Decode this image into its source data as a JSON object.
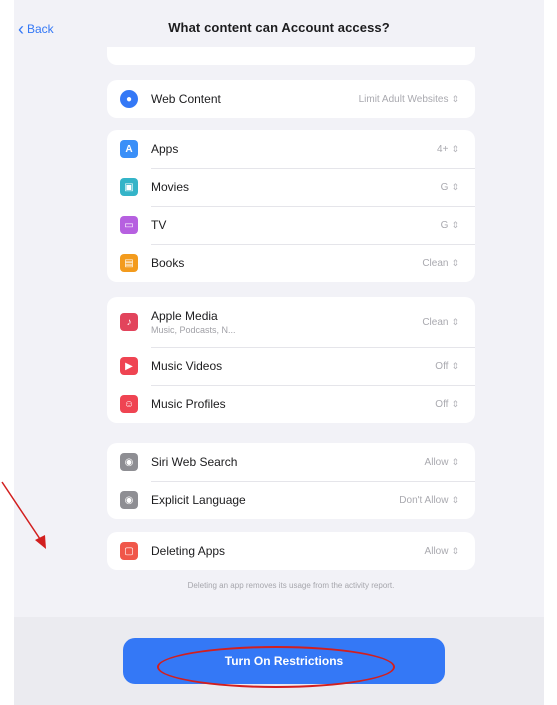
{
  "nav": {
    "back_label": "Back",
    "title": "What content can Account access?"
  },
  "groups": [
    {
      "rows": [
        {
          "label": "Web Content",
          "value": "Limit Adult Websites",
          "icon": "globe-icon",
          "color": "#3478f6"
        }
      ]
    },
    {
      "rows": [
        {
          "label": "Apps",
          "value": "4+",
          "icon": "app-store-icon",
          "color": "#3a8ff8"
        },
        {
          "label": "Movies",
          "value": "G",
          "icon": "film-icon",
          "color": "#34b4c8"
        },
        {
          "label": "TV",
          "value": "G",
          "icon": "tv-icon",
          "color": "#b660e0"
        },
        {
          "label": "Books",
          "value": "Clean",
          "icon": "book-icon",
          "color": "#f39b1d"
        }
      ]
    },
    {
      "rows": [
        {
          "label": "Apple Media",
          "sublabel": "Music, Podcasts, N...",
          "value": "Clean",
          "icon": "media-icon",
          "color": "#e2445c"
        },
        {
          "label": "Music Videos",
          "value": "Off",
          "icon": "music-video-icon",
          "color": "#ef4452"
        },
        {
          "label": "Music Profiles",
          "value": "Off",
          "icon": "music-profile-icon",
          "color": "#ef4452"
        }
      ]
    },
    {
      "rows": [
        {
          "label": "Siri Web Search",
          "value": "Allow",
          "icon": "siri-icon",
          "color": "#8e8e93"
        },
        {
          "label": "Explicit Language",
          "value": "Don't Allow",
          "icon": "siri-icon",
          "color": "#8e8e93"
        }
      ]
    },
    {
      "rows": [
        {
          "label": "Deleting Apps",
          "value": "Allow",
          "icon": "delete-app-icon",
          "color": "#f0574a"
        }
      ]
    }
  ],
  "footnote": "Deleting an app removes its usage from the activity report.",
  "cta_label": "Turn On Restrictions",
  "annotation_color": "#d21f1f"
}
